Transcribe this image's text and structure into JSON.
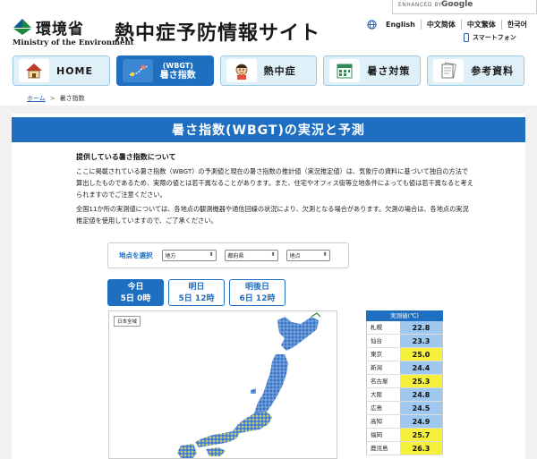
{
  "header": {
    "ministry_ja": "環境省",
    "ministry_en": "Ministry of the Environment",
    "site_title": "熱中症予防情報サイト",
    "search_enhanced": "ENHANCED BY",
    "search_brand": "Google"
  },
  "languages": [
    "English",
    "中文简体",
    "中文繁体",
    "한국어"
  ],
  "mobile_label": "スマートフォン",
  "nav": [
    {
      "label": "HOME",
      "icon": "house-icon"
    },
    {
      "label_small": "(WBGT)",
      "label": "暑さ指数",
      "icon": "map-pin-icon",
      "active": true
    },
    {
      "label": "熱中症",
      "icon": "person-icon"
    },
    {
      "label": "暑さ対策",
      "icon": "calendar-icon"
    },
    {
      "label": "参考資料",
      "icon": "document-icon"
    }
  ],
  "breadcrumb": {
    "home": "ホーム",
    "separator": ">",
    "current": "暑さ指数"
  },
  "section_title": "暑さ指数(WBGT)の実況と予測",
  "intro": {
    "heading": "提供している暑さ指数について",
    "p1": "ここに掲載されている暑さ指数（WBGT）の予測値と現在の暑さ指数の推計値（実況推定値）は、気象庁の資料に基づいて独自の方法で算出したものであるため、実際の値とは若干異なることがあります。また、住宅やオフィス街等立地条件によっても値は若干異なると考えられますのでご注意ください。",
    "p2": "全国11か所の実測値については、各地点の観測機器や通信回線の状況により、欠測となる場合があります。欠測の場合は、各地点の実況推定値を使用していますので、ご了承ください。"
  },
  "selector": {
    "label": "地点を選択",
    "options": [
      "地方",
      "都府県",
      "地点"
    ]
  },
  "day_tabs": [
    {
      "line1": "今日",
      "line2": "5日 0時",
      "active": true
    },
    {
      "line1": "明日",
      "line2": "5日 12時",
      "active": false
    },
    {
      "line1": "明後日",
      "line2": "6日 12時",
      "active": false
    }
  ],
  "map": {
    "label": "日本全域"
  },
  "observed": {
    "header": "実測値(℃)",
    "rows": [
      {
        "city": "札幌",
        "value": "22.8",
        "color": "#9ec8f0"
      },
      {
        "city": "仙台",
        "value": "23.3",
        "color": "#9ec8f0"
      },
      {
        "city": "東京",
        "value": "25.0",
        "color": "#f5f03c"
      },
      {
        "city": "新潟",
        "value": "24.4",
        "color": "#9ec8f0"
      },
      {
        "city": "名古屋",
        "value": "25.3",
        "color": "#f5f03c"
      },
      {
        "city": "大阪",
        "value": "24.8",
        "color": "#9ec8f0"
      },
      {
        "city": "広島",
        "value": "24.5",
        "color": "#9ec8f0"
      },
      {
        "city": "高知",
        "value": "24.9",
        "color": "#9ec8f0"
      },
      {
        "city": "福岡",
        "value": "25.7",
        "color": "#f5f03c"
      },
      {
        "city": "鹿児島",
        "value": "26.3",
        "color": "#f5f03c"
      }
    ]
  }
}
